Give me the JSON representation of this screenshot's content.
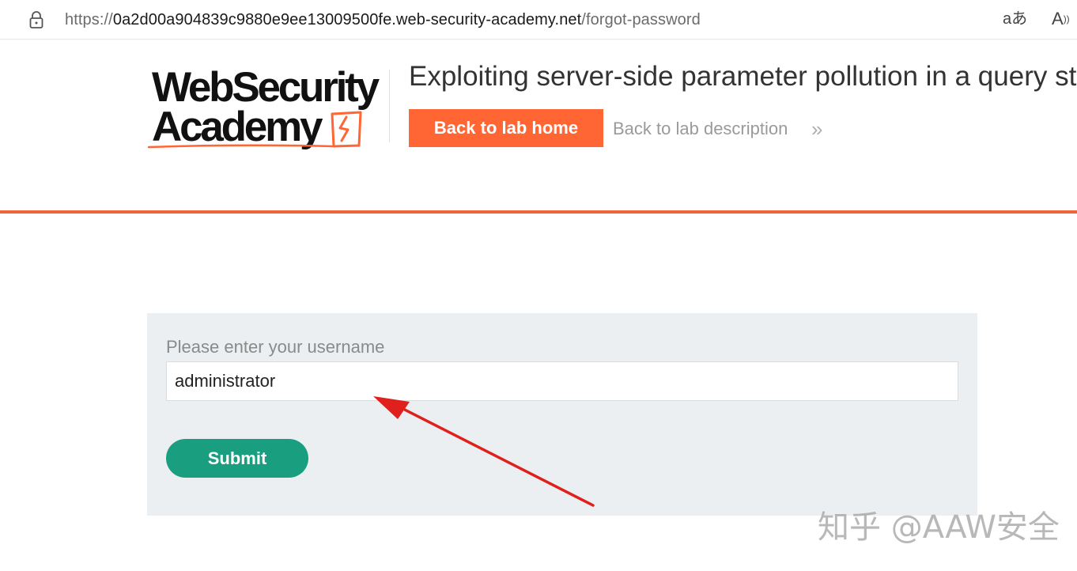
{
  "browser": {
    "url_scheme": "https://",
    "url_host": "0a2d00a904839c9880e9ee13009500fe.web-security-academy.net",
    "url_path": "/forgot-password",
    "translate_glyph": "aあ",
    "read_aloud_glyph": "A"
  },
  "header": {
    "logo_line1": "WebSecurity",
    "logo_line2": "Academy",
    "lab_title": "Exploiting server-side parameter pollution in a query string",
    "back_home_label": "Back to lab home",
    "back_description_label": "Back to lab description",
    "chevrons_glyph": "»"
  },
  "form": {
    "label": "Please enter your username",
    "username_value": "administrator",
    "submit_label": "Submit"
  },
  "watermark": "知乎 @AAW安全",
  "colors": {
    "brand_orange": "#ff6633",
    "submit_green": "#1a9e80",
    "card_bg": "#ebeff1",
    "annotation_red": "#e0201c"
  }
}
